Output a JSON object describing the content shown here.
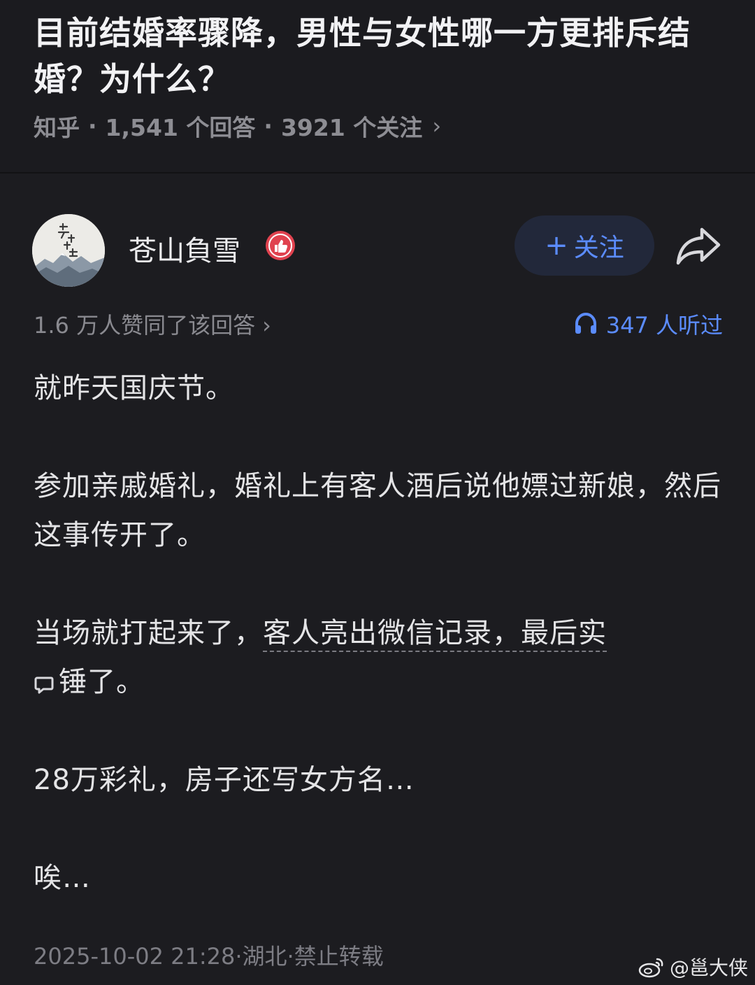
{
  "question": {
    "title": "目前结婚率骤降，男性与女性哪一方更排斥结婚？为什么？",
    "source": "知乎",
    "answer_count": "1,541 个回答",
    "follow_count": "3921 个关注",
    "separator": "·",
    "chevron": "›"
  },
  "author": {
    "name": "苍山負雪",
    "avatar_text": "苍山負雪",
    "follow_button": "关注",
    "follow_plus": "+"
  },
  "stats": {
    "likes": "1.6 万人赞同了该回答",
    "chevron": "›",
    "listens": "347 人听过"
  },
  "content": {
    "p1": "就昨天国庆节。",
    "p2": "参加亲戚婚礼，婚礼上有客人酒后说他嫖过新娘，然后这事传开了。",
    "p3_prefix": "当场就打起来了，",
    "p3_highlight": "客人亮出微信记录，最后实",
    "p3_suffix": "锤了。",
    "p4": "28万彩礼，房子还写女方名…",
    "p5": "唉…"
  },
  "footer": {
    "meta": "2025-10-02 21:28·湖北·禁止转载"
  },
  "watermark": {
    "text": "@邕大侠"
  },
  "colors": {
    "background": "#1c1c20",
    "accent": "#5b8cff",
    "badge": "#e0424f"
  }
}
